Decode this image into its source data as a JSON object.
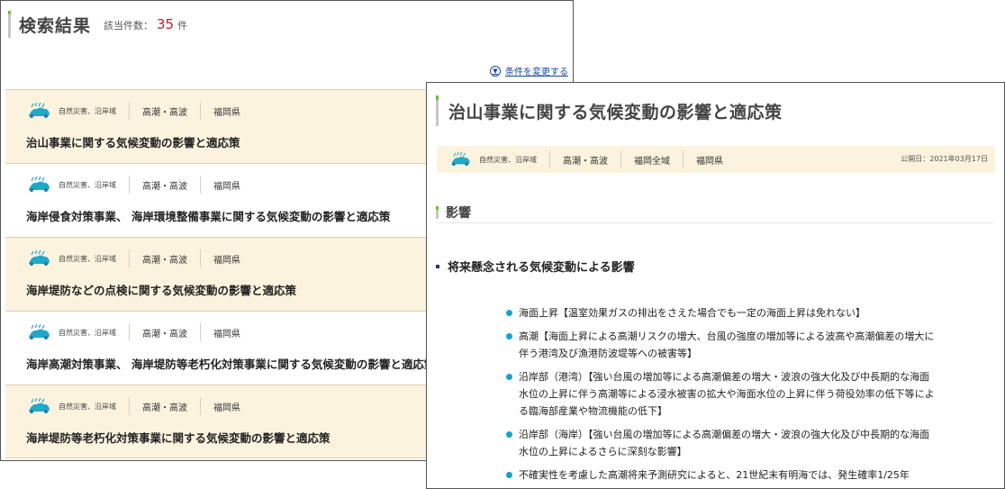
{
  "left": {
    "title": "検索結果",
    "count_label": "該当件数：",
    "count_value": "35",
    "count_unit": "件",
    "change_link": "条件を変更する",
    "items": [
      {
        "category": "自然災害、沿岸域",
        "tag1": "高潮・高波",
        "tag2": "福岡県",
        "title": "治山事業に関する気候変動の影響と適応策"
      },
      {
        "category": "自然災害、沿岸域",
        "tag1": "高潮・高波",
        "tag2": "福岡県",
        "title": "海岸侵食対策事業、 海岸環境整備事業に関する気候変動の影響と適応策"
      },
      {
        "category": "自然災害、沿岸域",
        "tag1": "高潮・高波",
        "tag2": "福岡県",
        "title": "海岸堤防などの点検に関する気候変動の影響と適応策"
      },
      {
        "category": "自然災害、沿岸域",
        "tag1": "高潮・高波",
        "tag2": "福岡県",
        "title": "海岸高潮対策事業、 海岸堤防等老朽化対策事業に関する気候変動の影響と適応策"
      },
      {
        "category": "自然災害、沿岸域",
        "tag1": "高潮・高波",
        "tag2": "福岡県",
        "title": "海岸堤防等老朽化対策事業に関する気候変動の影響と適応策"
      }
    ]
  },
  "detail": {
    "title": "治山事業に関する気候変動の影響と適応策",
    "category": "自然災害、沿岸域",
    "tag1": "高潮・高波",
    "tag2": "福岡全域",
    "tag3": "福岡県",
    "publish": "公開日：2021年03月17日",
    "section": "影響",
    "subsection": "将来懸念される気候変動による影響",
    "impacts": [
      "海面上昇【温室効果ガスの排出をさえた場合でも一定の海面上昇は免れない】",
      "高潮【海面上昇による高潮リスクの増大、台風の強度の増加等による波高や高潮偏差の増大に伴う港湾及び漁港防波堤等への被害等】",
      "沿岸部（港湾）【強い台風の増加等による高潮偏差の増大・波浪の強大化及び中長期的な海面水位の上昇に伴う高潮等による浸水被害の拡大や海面水位の上昇に伴う荷役効率の低下等による臨海部産業や物流機能の低下】",
      "沿岸部（海岸）【強い台風の増加等による高潮偏差の増大・波浪の強大化及び中長期的な海面水位の上昇によるさらに深刻な影響】",
      "不確実性を考慮した高潮将来予測研究によると、21世紀末有明海では、発生確率1/25年"
    ]
  },
  "icons": {
    "wave": "wave-disaster-icon",
    "change": "chevron-down-circle-icon"
  },
  "colors": {
    "accent_green": "#6bbf2a",
    "count_red": "#b0252a",
    "link_blue": "#1a4a9c",
    "row_shade": "#fcf3de",
    "bullet_blue": "#15a3cf"
  }
}
